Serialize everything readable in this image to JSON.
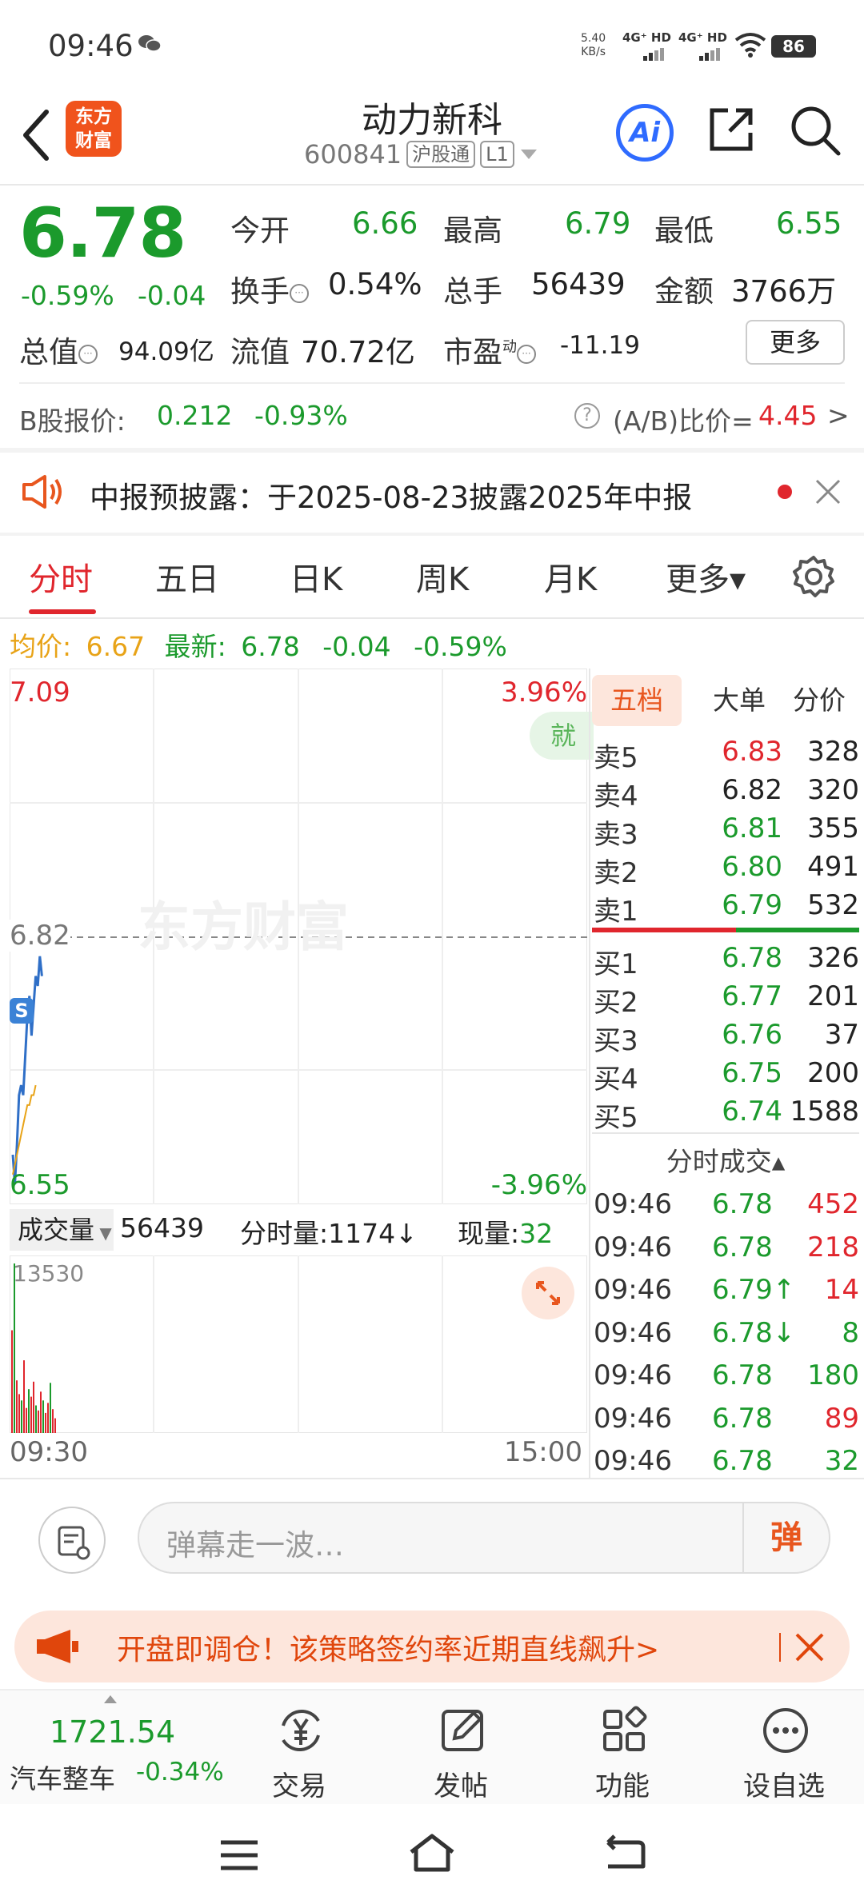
{
  "status_bar": {
    "time": "09:46",
    "net_speed": "5.40",
    "net_unit": "KB/s",
    "sim1": "4G⁺ HD",
    "sim2": "4G⁺ HD",
    "battery": "86"
  },
  "header": {
    "logo_line1": "东方",
    "logo_line2": "财富",
    "stock_name": "动力新科",
    "stock_code": "600841",
    "market_tag": "沪股通",
    "level_tag": "L1",
    "ai_label": "Ai"
  },
  "quote": {
    "price": "6.78",
    "change_pct": "-0.59%",
    "change_abs": "-0.04",
    "open_label": "今开",
    "open": "6.66",
    "high_label": "最高",
    "high": "6.79",
    "low_label": "最低",
    "low": "6.55",
    "turnover_label": "换手",
    "turnover": "0.54%",
    "volume_label": "总手",
    "volume": "56439",
    "amount_label": "金额",
    "amount": "3766万",
    "mktcap_label": "总值",
    "mktcap": "94.09亿",
    "float_label": "流值",
    "float": "70.72亿",
    "pe_label": "市盈",
    "pe_sup": "动",
    "pe": "-11.19",
    "more": "更多"
  },
  "b_share": {
    "label": "B股报价:",
    "price": "0.212",
    "pct": "-0.93%",
    "ratio_label": "(A/B)比价=",
    "ratio": "4.45",
    "arrow": ">"
  },
  "notice": {
    "text": "中报预披露：于2025-08-23披露2025年中报"
  },
  "tabs": [
    "分时",
    "五日",
    "日K",
    "周K",
    "月K",
    "更多▾"
  ],
  "avg_row": {
    "avg_label": "均价:",
    "avg": "6.67",
    "latest_label": "最新:",
    "latest": "6.78",
    "chg": "-0.04",
    "pct": "-0.59%"
  },
  "chart": {
    "y_max": "7.09",
    "y_min": "6.55",
    "pct_max": "3.96%",
    "pct_min": "-3.96%",
    "ref_price": "6.82",
    "jiu_badge": "就",
    "watermark": "东方财富",
    "s_marker": "S",
    "vol_max_label": "13530",
    "time_start": "09:30",
    "time_end": "15:00"
  },
  "chart_data": {
    "type": "line",
    "title": "",
    "ylim": [
      6.55,
      7.09
    ],
    "prev_close": 6.82,
    "series": [
      {
        "values": [
          6.6,
          6.57,
          6.61,
          6.66,
          6.67,
          6.66,
          6.7,
          6.74,
          6.76,
          6.72,
          6.75,
          6.78,
          6.77,
          6.8,
          6.78
        ]
      },
      {
        "values": [
          6.58,
          6.59,
          6.6,
          6.61,
          6.62,
          6.63,
          6.64,
          6.65,
          6.65,
          6.66,
          6.66,
          6.67
        ]
      }
    ],
    "volume": [
      8200,
      13530,
      4200,
      3100,
      2600,
      5800,
      2000,
      3500,
      2900,
      4100,
      2200,
      1800,
      3300,
      2600,
      1600,
      2400,
      4000,
      1900,
      1174
    ]
  },
  "volume_row": {
    "selector": "成交量",
    "total": "56439",
    "fs_label": "分时量:",
    "fs_val": "1174↓",
    "now_label": "现量:",
    "now_val": "32"
  },
  "orderbook_tabs": [
    "五档",
    "大单",
    "分价"
  ],
  "asks": [
    {
      "label": "卖5",
      "price": "6.83",
      "vol": "328",
      "color": "#e0262d"
    },
    {
      "label": "卖4",
      "price": "6.82",
      "vol": "320",
      "color": "#222222"
    },
    {
      "label": "卖3",
      "price": "6.81",
      "vol": "355",
      "color": "#1b9a2c"
    },
    {
      "label": "卖2",
      "price": "6.80",
      "vol": "491",
      "color": "#1b9a2c"
    },
    {
      "label": "卖1",
      "price": "6.79",
      "vol": "532",
      "color": "#1b9a2c"
    }
  ],
  "bids": [
    {
      "label": "买1",
      "price": "6.78",
      "vol": "326",
      "color": "#1b9a2c"
    },
    {
      "label": "买2",
      "price": "6.77",
      "vol": "201",
      "color": "#1b9a2c"
    },
    {
      "label": "买3",
      "price": "6.76",
      "vol": "37",
      "color": "#1b9a2c"
    },
    {
      "label": "买4",
      "price": "6.75",
      "vol": "200",
      "color": "#1b9a2c"
    },
    {
      "label": "买5",
      "price": "6.74",
      "vol": "1588",
      "color": "#1b9a2c"
    }
  ],
  "trades_header": "分时成交▴",
  "trades": [
    {
      "time": "09:46",
      "price": "6.78",
      "vol": "452",
      "color": "#e0262d"
    },
    {
      "time": "09:46",
      "price": "6.78",
      "vol": "218",
      "color": "#e0262d"
    },
    {
      "time": "09:46",
      "price": "6.79↑",
      "vol": "14",
      "color": "#e0262d"
    },
    {
      "time": "09:46",
      "price": "6.78↓",
      "vol": "8",
      "color": "#1b9a2c"
    },
    {
      "time": "09:46",
      "price": "6.78",
      "vol": "180",
      "color": "#1b9a2c"
    },
    {
      "time": "09:46",
      "price": "6.78",
      "vol": "89",
      "color": "#e0262d"
    },
    {
      "time": "09:46",
      "price": "6.78",
      "vol": "32",
      "color": "#1b9a2c"
    }
  ],
  "comment": {
    "placeholder": "弹幕走一波…",
    "danmu_btn": "弹"
  },
  "promo": {
    "text": "开盘即调仓！该策略签约率近期直线飙升>"
  },
  "bottom_nav": {
    "index_value": "1721.54",
    "index_name": "汽车整车",
    "index_change": "-0.34%",
    "items": [
      "交易",
      "发帖",
      "功能",
      "设自选"
    ]
  }
}
